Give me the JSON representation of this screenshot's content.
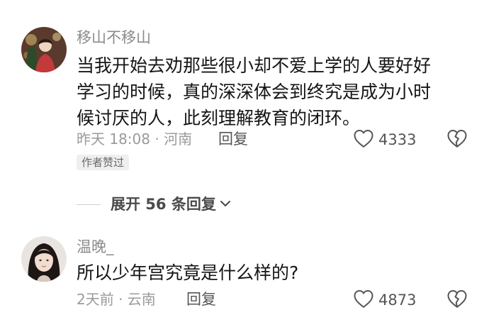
{
  "comments": [
    {
      "username": "移山不移山",
      "text_lines": [
        "当我开始去劝那些很小却不爱上学的人要好好",
        "学习的时候，真的深深体会到终究是成为小时",
        "候讨厌的人，此刻理解教育的闭环。"
      ],
      "meta": "昨天 18:08 · 河南",
      "reply_label": "回复",
      "likes": "4333",
      "badge": "作者赞过",
      "expand_label": "展开 56 条回复"
    },
    {
      "username": "温晚_",
      "text": "所以少年宫究竟是什么样的?",
      "meta": "2天前 · 云南",
      "reply_label": "回复",
      "likes": "4873"
    }
  ],
  "icons": {
    "like": "heart-outline-icon",
    "dislike": "broken-heart-icon",
    "expand": "chevron-down-icon"
  },
  "colors": {
    "text": "#151515",
    "muted": "#9a9a9a",
    "username": "#8a8a8a",
    "badge_bg": "#efefef"
  }
}
